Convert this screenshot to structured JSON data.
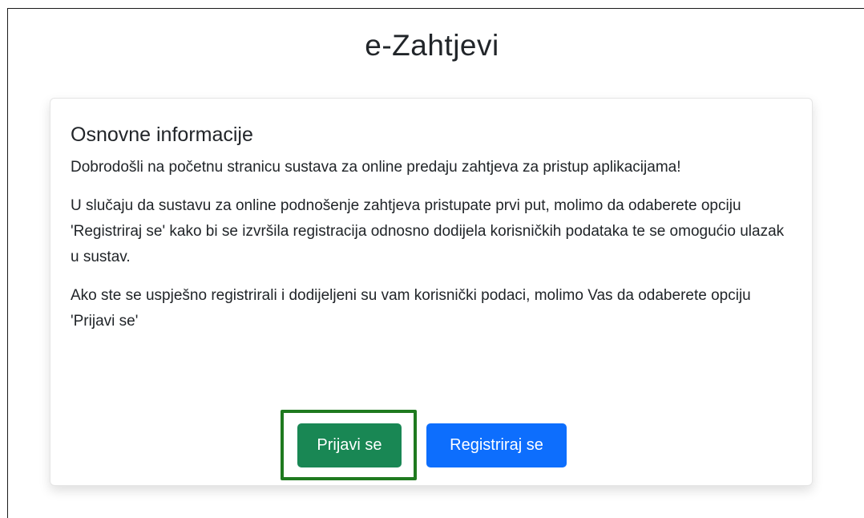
{
  "page": {
    "title": "e-Zahtjevi"
  },
  "card": {
    "title": "Osnovne informacije",
    "paragraphs": [
      "Dobrodošli na početnu stranicu sustava za online predaju zahtjeva za pristup aplikacijama!",
      "U slučaju da sustavu za online podnošenje zahtjeva pristupate prvi put, molimo da odaberete opciju 'Registriraj se' kako bi se izvršila registracija odnosno dodijela korisničkih podataka te se omogućio ulazak u sustav.",
      "Ako ste se uspješno registrirali i dodijeljeni su vam korisnički podaci, molimo Vas da odaberete opciju 'Prijavi se'"
    ],
    "buttons": {
      "login_label": "Prijavi se",
      "register_label": "Registriraj se"
    }
  },
  "colors": {
    "login_button": "#198754",
    "register_button": "#0d6efd",
    "highlight_border": "#1f7a1f"
  }
}
